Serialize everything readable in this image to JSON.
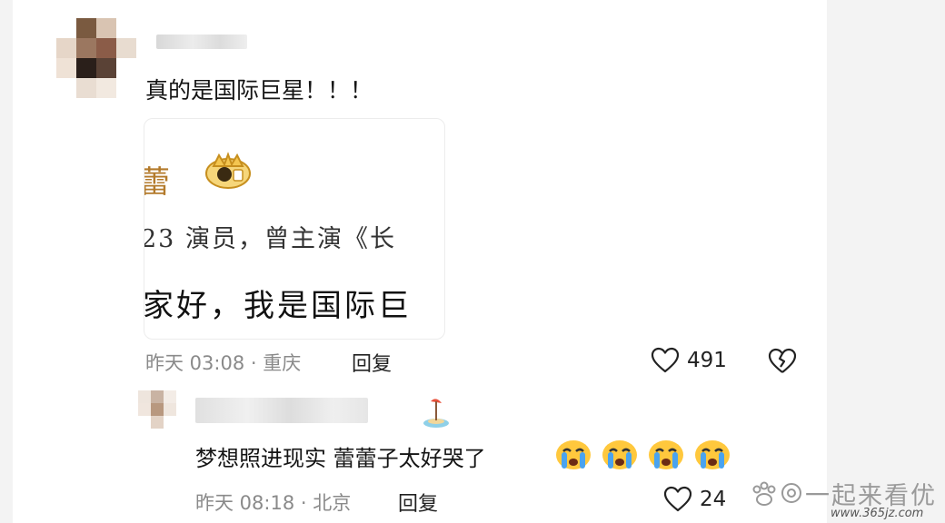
{
  "comment1": {
    "text": "真的是国际巨星！！！",
    "quote": {
      "name_fragment": "蕾",
      "desc_fragment": "23 演员，曾主演《长",
      "text_fragment": "家好，我是国际巨"
    },
    "time": "昨天 03:08 · 重庆",
    "reply_label": "回复",
    "likes": "491"
  },
  "comment2": {
    "text": "梦想照进现实 蕾蕾子太好哭了",
    "time": "昨天 08:18 · 北京",
    "reply_label": "回复",
    "likes": "24"
  },
  "watermark": {
    "title": "一起来看优",
    "url": "www.365jz.com"
  },
  "colors": {
    "background": "#ffffff",
    "meta": "#8a8a8a",
    "gold": "#b37a2b",
    "emoji_yellow": "#ffc83d",
    "emoji_tear": "#4aa3ef"
  }
}
